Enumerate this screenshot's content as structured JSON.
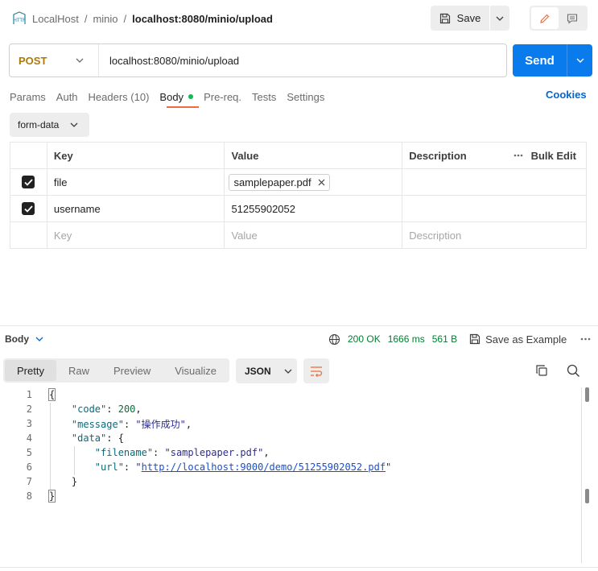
{
  "breadcrumb": {
    "badge": "HTTP",
    "items": [
      "LocalHost",
      "minio"
    ],
    "current": "localhost:8080/minio/upload",
    "separator": "/"
  },
  "toolbar": {
    "save_label": "Save"
  },
  "request": {
    "method": "POST",
    "url": "localhost:8080/minio/upload",
    "send_label": "Send"
  },
  "tabs": [
    {
      "label": "Params"
    },
    {
      "label": "Auth"
    },
    {
      "label": "Headers (10)"
    },
    {
      "label": "Body",
      "active": true
    },
    {
      "label": "Pre-req."
    },
    {
      "label": "Tests"
    },
    {
      "label": "Settings"
    }
  ],
  "cookies_label": "Cookies",
  "body_type": "form-data",
  "table": {
    "headers": {
      "key": "Key",
      "value": "Value",
      "description": "Description",
      "bulk_edit": "Bulk Edit"
    },
    "rows": [
      {
        "checked": true,
        "key": "file",
        "value": "samplepaper.pdf",
        "value_type": "file"
      },
      {
        "checked": true,
        "key": "username",
        "value": "51255902052",
        "value_type": "text"
      }
    ],
    "placeholders": {
      "key": "Key",
      "value": "Value",
      "description": "Description"
    }
  },
  "response": {
    "label": "Body",
    "status": "200 OK",
    "time": "1666 ms",
    "size": "561 B",
    "save_example_label": "Save as Example",
    "view_tabs": [
      "Pretty",
      "Raw",
      "Preview",
      "Visualize"
    ],
    "active_view": "Pretty",
    "format": "JSON",
    "code_lines": [
      "1",
      "2",
      "3",
      "4",
      "5",
      "6",
      "7",
      "8"
    ],
    "json": {
      "open_brace": "{",
      "close_brace": "}",
      "code_key": "\"code\"",
      "code_val": "200",
      "message_key": "\"message\"",
      "message_val": "\"操作成功\"",
      "data_key": "\"data\"",
      "filename_key": "\"filename\"",
      "filename_val": "\"samplepaper.pdf\"",
      "url_key": "\"url\"",
      "url_val": "http://localhost:9000/demo/51255902052.pdf"
    }
  },
  "colors": {
    "accent": "#097bed",
    "method": "#ad7a03",
    "active_tab": "#f26b3a",
    "status_ok": "#007f31",
    "body_dot": "#0cbb52"
  }
}
